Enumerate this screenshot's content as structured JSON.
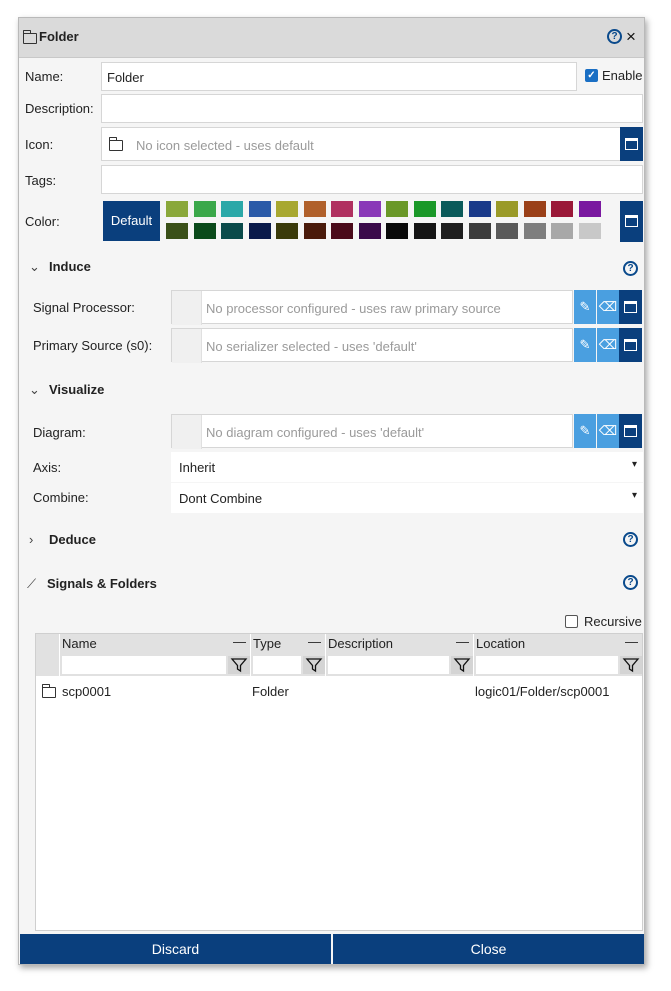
{
  "dialog": {
    "title": "Folder",
    "help_icon": "?",
    "close_icon": "×"
  },
  "fields": {
    "name_label": "Name:",
    "name_value": "Folder",
    "enable_label": "Enable",
    "enable_checked": true,
    "description_label": "Description:",
    "description_value": "",
    "icon_label": "Icon:",
    "icon_placeholder": "No icon selected - uses default",
    "tags_label": "Tags:",
    "tags_value": "",
    "color_label": "Color:",
    "color_default_label": "Default",
    "color_swatches_row1": [
      "#8aa83a",
      "#3aa84a",
      "#2aa8a8",
      "#2a5aa8",
      "#a8a830",
      "#b0602a",
      "#b03060",
      "#8a38b8",
      "#6a9828",
      "#1a9828",
      "#0a5a5a",
      "#1a3a8a",
      "#9a9a28",
      "#9a4018",
      "#9a1838",
      "#7a18a0"
    ],
    "color_swatches_row2": [
      "#3a5018",
      "#0a4a1a",
      "#0a4a4a",
      "#0a1a4a",
      "#3a3a0a",
      "#4a1a0a",
      "#4a0a1a",
      "#3a0a4a",
      "#0a0a0a",
      "#141414",
      "#1e1e1e",
      "#3c3c3c",
      "#5a5a5a",
      "#7e7e7e",
      "#a8a8a8",
      "#c8c8c8"
    ]
  },
  "sections": {
    "induce": {
      "title": "Induce",
      "chevron": "⌄",
      "signal_processor_label": "Signal Processor:",
      "signal_processor_placeholder": "No processor configured - uses raw primary source",
      "primary_source_label": "Primary Source (s0):",
      "primary_source_placeholder": "No serializer selected - uses 'default'"
    },
    "visualize": {
      "title": "Visualize",
      "chevron": "⌄",
      "diagram_label": "Diagram:",
      "diagram_placeholder": "No diagram configured - uses 'default'",
      "axis_label": "Axis:",
      "axis_value": "Inherit",
      "combine_label": "Combine:",
      "combine_value": "Dont Combine"
    },
    "deduce": {
      "title": "Deduce",
      "chevron": "›"
    },
    "signals": {
      "title": "Signals & Folders",
      "recursive_label": "Recursive",
      "recursive_checked": false
    }
  },
  "table": {
    "columns": [
      "Name",
      "Type",
      "Description",
      "Location"
    ],
    "column_menu": "—",
    "rows": [
      {
        "name": "scp0001",
        "type": "Folder",
        "description": "",
        "location": "logic01/Folder/scp0001"
      }
    ]
  },
  "footer": {
    "discard_label": "Discard",
    "close_label": "Close"
  },
  "colors": {
    "accent_dark": "#0a3f7d",
    "accent_light": "#4a9fe0"
  }
}
